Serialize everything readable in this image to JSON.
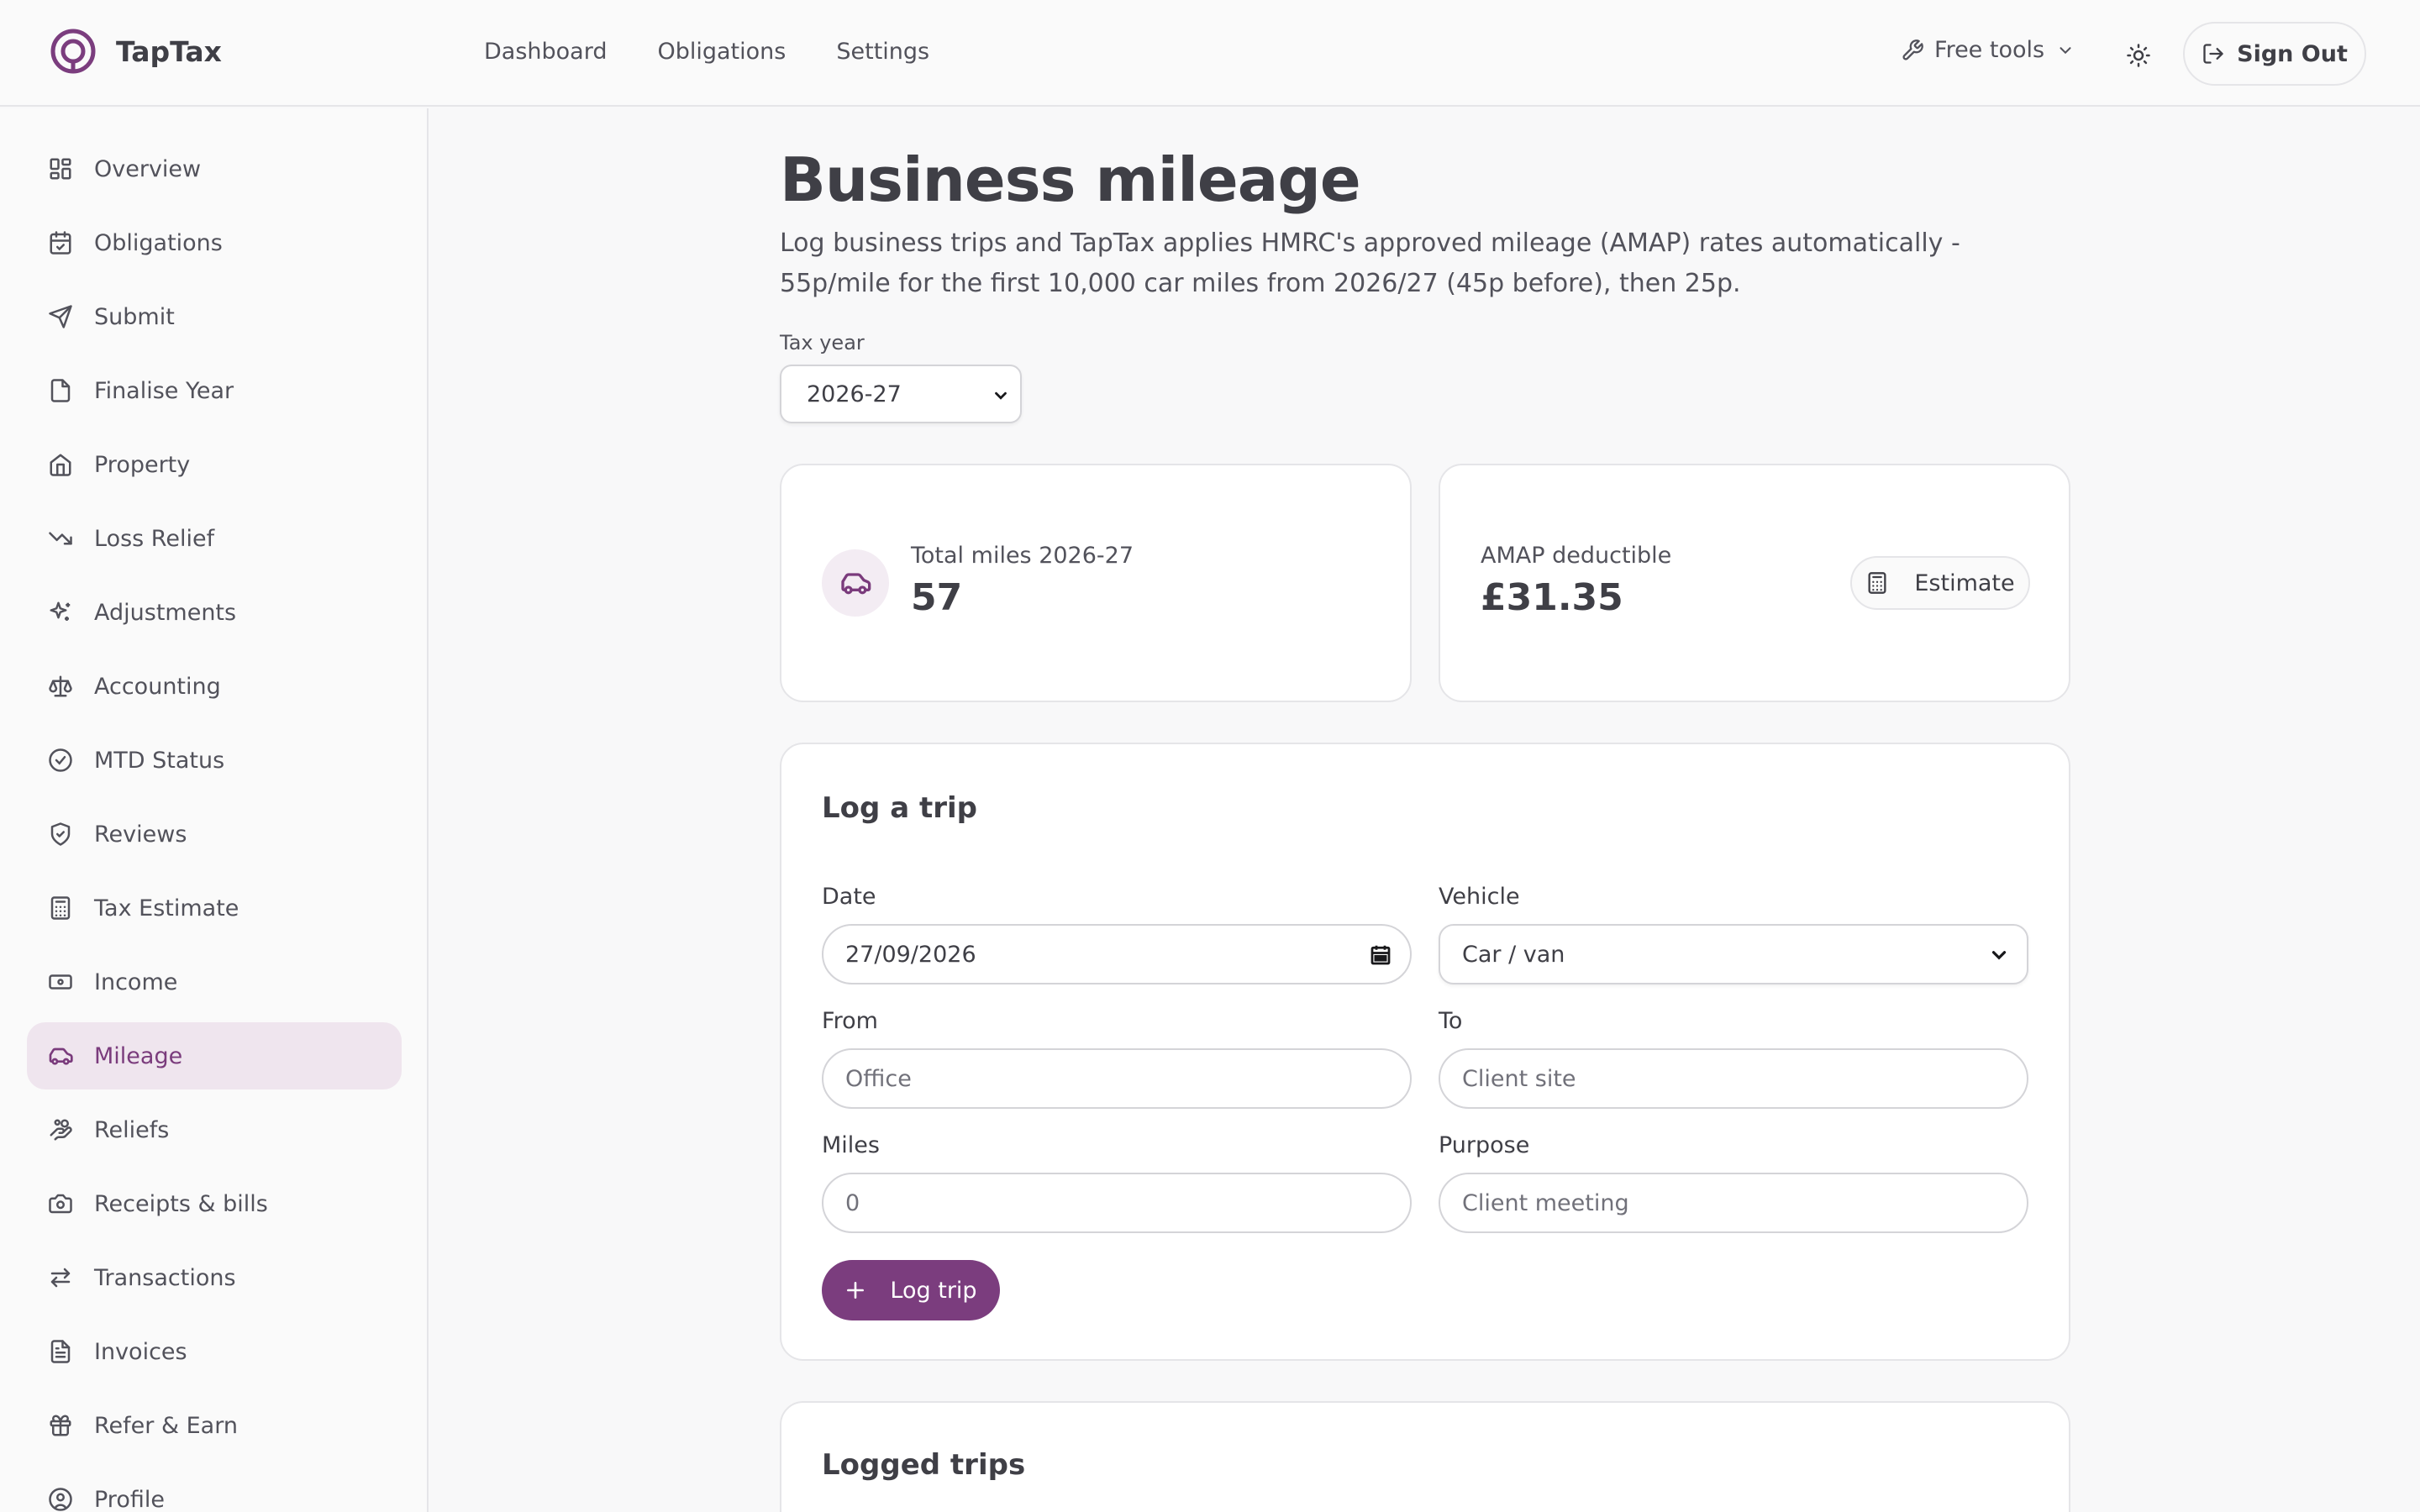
{
  "header": {
    "brand": "TapTax",
    "nav": [
      "Dashboard",
      "Obligations",
      "Settings"
    ],
    "free_tools": "Free tools",
    "sign_out": "Sign Out"
  },
  "sidebar": {
    "items": [
      {
        "label": "Overview",
        "icon": "grid-icon"
      },
      {
        "label": "Obligations",
        "icon": "calendar-check-icon"
      },
      {
        "label": "Submit",
        "icon": "send-icon"
      },
      {
        "label": "Finalise Year",
        "icon": "file-icon"
      },
      {
        "label": "Property",
        "icon": "home-icon"
      },
      {
        "label": "Loss Relief",
        "icon": "trending-down-icon"
      },
      {
        "label": "Adjustments",
        "icon": "sparkles-icon"
      },
      {
        "label": "Accounting",
        "icon": "scale-icon"
      },
      {
        "label": "MTD Status",
        "icon": "check-circle-icon"
      },
      {
        "label": "Reviews",
        "icon": "shield-check-icon"
      },
      {
        "label": "Tax Estimate",
        "icon": "calculator-icon"
      },
      {
        "label": "Income",
        "icon": "banknote-icon"
      },
      {
        "label": "Mileage",
        "icon": "car-icon"
      },
      {
        "label": "Reliefs",
        "icon": "hand-coins-icon"
      },
      {
        "label": "Receipts & bills",
        "icon": "camera-icon"
      },
      {
        "label": "Transactions",
        "icon": "arrows-exchange-icon"
      },
      {
        "label": "Invoices",
        "icon": "file-text-icon"
      },
      {
        "label": "Refer & Earn",
        "icon": "gift-icon"
      },
      {
        "label": "Profile",
        "icon": "user-circle-icon"
      }
    ],
    "active": "Mileage"
  },
  "main": {
    "title": "Business mileage",
    "description": "Log business trips and TapTax applies HMRC's approved mileage (AMAP) rates automatically - 55p/mile for the first 10,000 car miles from 2026/27 (45p before), then 25p.",
    "tax_year_label": "Tax year",
    "tax_year_value": "2026-27",
    "stats": {
      "total_label": "Total miles 2026-27",
      "total_value": "57",
      "amap_label": "AMAP deductible",
      "amap_value": "£31.35",
      "estimate_button": "Estimate"
    },
    "log_trip": {
      "title": "Log a trip",
      "date_label": "Date",
      "date_value": "27/09/2026",
      "vehicle_label": "Vehicle",
      "vehicle_value": "Car / van",
      "from_label": "From",
      "from_placeholder": "Office",
      "to_label": "To",
      "to_placeholder": "Client site",
      "miles_label": "Miles",
      "miles_value": "0",
      "purpose_label": "Purpose",
      "purpose_placeholder": "Client meeting",
      "submit": "Log trip"
    },
    "logged_trips_title": "Logged trips"
  },
  "colors": {
    "accent": "#7b3d7e",
    "active_bg": "#efe5ee",
    "background": "#f8f8f9"
  }
}
